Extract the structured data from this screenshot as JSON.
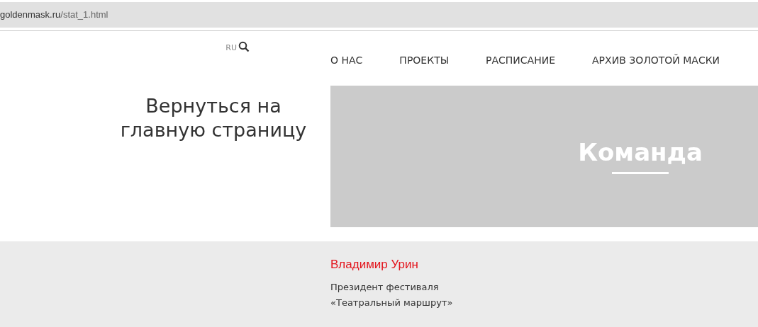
{
  "address_bar": {
    "domain": "goldenmask.ru",
    "path": "/stat_1.html"
  },
  "header": {
    "language": {
      "label": "RU",
      "selected": true
    },
    "nav": [
      "О НАС",
      "ПРОЕКТЫ",
      "РАСПИСАНИЕ",
      "АРХИВ ЗОЛОТОЙ МАСКИ"
    ]
  },
  "back_link": "Вернуться на главную страницу",
  "banner": {
    "title": "Команда"
  },
  "person": {
    "name": "Владимир Урин",
    "role_lines": [
      "Президент фестиваля",
      "«Театральный маршрут»"
    ]
  }
}
